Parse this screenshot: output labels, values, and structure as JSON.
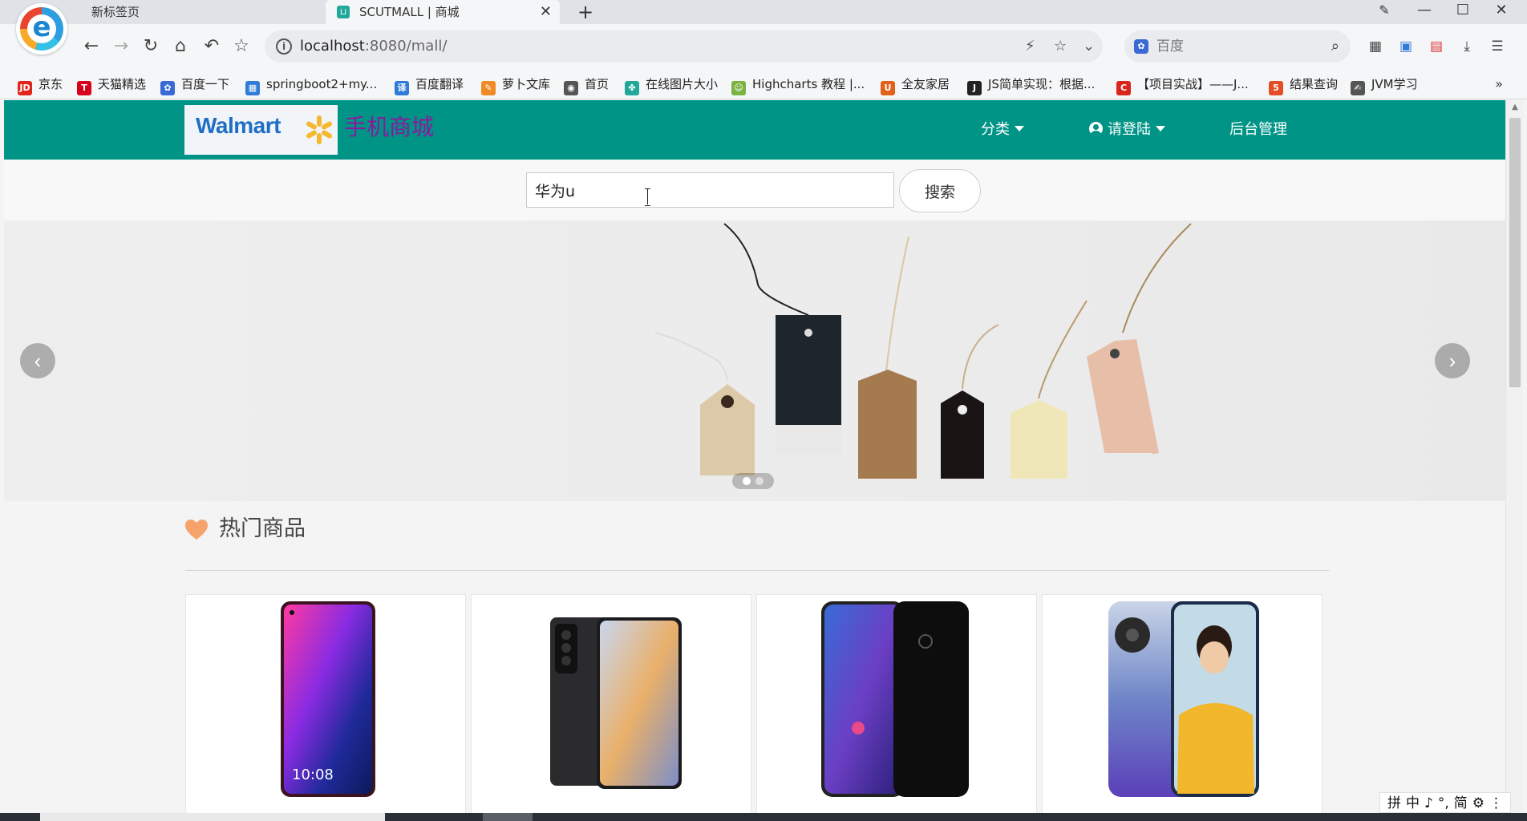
{
  "browser": {
    "tabs": [
      {
        "title": "新标签页",
        "active": false
      },
      {
        "title": "SCUTMALL | 商城",
        "active": true
      }
    ],
    "address": {
      "host": "localhost",
      "path": ":8080/mall/"
    },
    "search": {
      "placeholder": "百度"
    },
    "bookmarks": [
      {
        "label": "京东",
        "icon": "jd-icon",
        "color": "#e1251b",
        "glyph": "JD"
      },
      {
        "label": "天猫精选",
        "icon": "tmall-icon",
        "color": "#d6001c",
        "glyph": "T"
      },
      {
        "label": "百度一下",
        "icon": "baidu-paw-icon",
        "color": "#3b69d6",
        "glyph": "✿"
      },
      {
        "label": "springboot2+my...",
        "icon": "site-icon",
        "color": "#2f7bd8",
        "glyph": "▦"
      },
      {
        "label": "百度翻译",
        "icon": "translate-icon",
        "color": "#2f7bd8",
        "glyph": "译"
      },
      {
        "label": "萝卜文库",
        "icon": "carrot-icon",
        "color": "#f08a24",
        "glyph": "✎"
      },
      {
        "label": "首页",
        "icon": "globe-icon",
        "color": "#555555",
        "glyph": "◉"
      },
      {
        "label": "在线图片大小",
        "icon": "puzzle-icon",
        "color": "#21a89a",
        "glyph": "✤"
      },
      {
        "label": "Highcharts 教程 |...",
        "icon": "highcharts-icon",
        "color": "#7bb342",
        "glyph": "☺"
      },
      {
        "label": "全友家居",
        "icon": "quanu-icon",
        "color": "#e0611a",
        "glyph": "U"
      },
      {
        "label": "JS简单实现：根据...",
        "icon": "java-icon",
        "color": "#222222",
        "glyph": "J"
      },
      {
        "label": "【项目实战】——J...",
        "icon": "csdn-icon",
        "color": "#d9261c",
        "glyph": "C"
      },
      {
        "label": "结果查询",
        "icon": "html5-icon",
        "color": "#e44d26",
        "glyph": "5"
      },
      {
        "label": "JVM学习",
        "icon": "pen-icon",
        "color": "#555555",
        "glyph": "✍"
      }
    ],
    "more": "»"
  },
  "header": {
    "logo_text": "Walmart",
    "shop_title": "手机商城",
    "nav": {
      "category": "分类",
      "login": "请登陆",
      "admin": "后台管理"
    }
  },
  "search": {
    "value": "华为u",
    "button": "搜索"
  },
  "section": {
    "title": "热门商品"
  },
  "ime": {
    "items": [
      "拼",
      "中",
      "♪",
      "°,",
      "简",
      "⚙",
      "⋮"
    ]
  },
  "colors": {
    "header": "#009486",
    "shop_title": "#8a1a9e",
    "heart": "#f5a26b",
    "walmart_blue": "#1f6ec4",
    "spark": "#f5b82e"
  }
}
